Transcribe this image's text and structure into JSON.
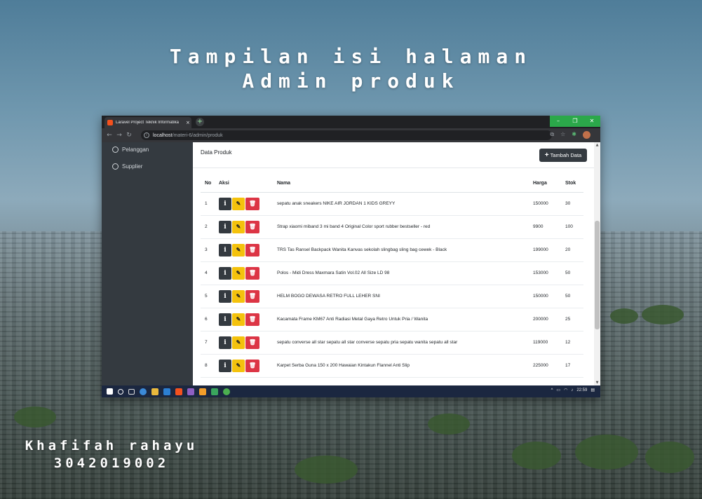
{
  "poster": {
    "title_line1": "Tampilan isi halaman",
    "title_line2": "Admin produk",
    "author_name": "Khafifah rahayu",
    "author_id": "3042019002"
  },
  "browser": {
    "tab_title": "Laravel Project Teknik Informatika",
    "tab_close": "×",
    "new_tab": "+",
    "url_host": "localhost",
    "url_path": "/materi-6/admin/produk",
    "window_minimize": "–",
    "window_maximize": "❐",
    "window_close": "✕"
  },
  "sidebar": {
    "items": [
      {
        "label": "Pelanggan"
      },
      {
        "label": "Supplier"
      }
    ]
  },
  "main": {
    "card_title": "Data Produk",
    "add_button": {
      "icon": "+",
      "label": "Tambah Data"
    },
    "table": {
      "headers": {
        "no": "No",
        "aksi": "Aksi",
        "nama": "Nama",
        "harga": "Harga",
        "stok": "Stok"
      },
      "rows": [
        {
          "no": "1",
          "nama": "sepatu anak sneakers NIKE AIR JORDAN 1 KIDS GREYY",
          "harga": "150000",
          "stok": "30"
        },
        {
          "no": "2",
          "nama": "Strap xiaomi miband 3 mi band 4 Original Color sport rubber bestseller - red",
          "harga": "9900",
          "stok": "100"
        },
        {
          "no": "3",
          "nama": "TRS Tas Ransel Backpack Wanita Kanvas sekolah slingbag sling bag cewek - Black",
          "harga": "199000",
          "stok": "20"
        },
        {
          "no": "4",
          "nama": "Polos - Midi Dress Maxmara Satin Vol.02 All Size LD 98",
          "harga": "153000",
          "stok": "50"
        },
        {
          "no": "5",
          "nama": "HELM BOGO DEWASA RETRO FULL LEHER SNI",
          "harga": "150000",
          "stok": "50"
        },
        {
          "no": "6",
          "nama": "Kacamata Frame KM67 Anti Radiasi Metal Gaya Retro Untuk Pria / Wanita",
          "harga": "200000",
          "stok": "25"
        },
        {
          "no": "7",
          "nama": "sepatu converse all star sepatu all star converse sepatu pria sepatu wanita sepatu all star",
          "harga": "119000",
          "stok": "12"
        },
        {
          "no": "8",
          "nama": "Karpet Serba Guna 150 x 200 Hawaian Kintakun Flannel Anti Slip",
          "harga": "225000",
          "stok": "17"
        }
      ],
      "actions": {
        "info_icon": "i",
        "edit_icon": "✎",
        "delete_icon": "🗑"
      }
    }
  },
  "taskbar": {
    "clock": "22:59"
  },
  "colors": {
    "sidebar_bg": "#343a40",
    "info_button": "#343a40",
    "edit_button": "#f4c20d",
    "delete_button": "#dc3545",
    "window_controls": "#2ba84a"
  }
}
